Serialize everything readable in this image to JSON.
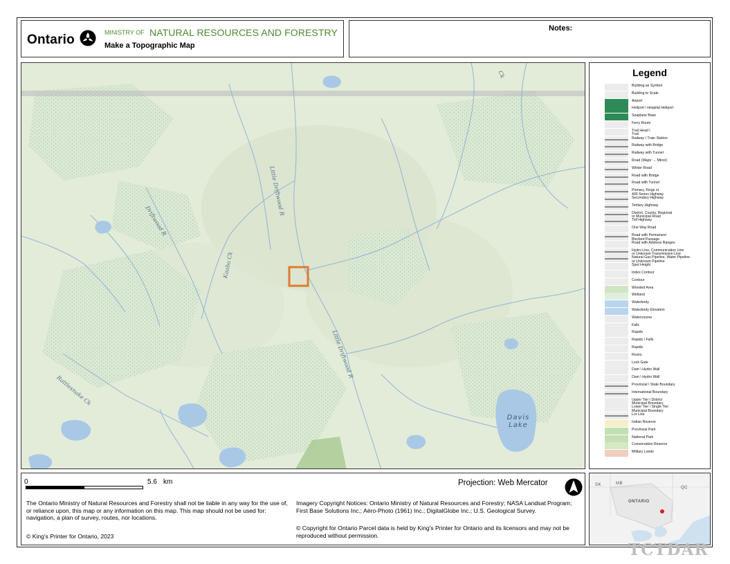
{
  "header": {
    "brand": "Ontario",
    "ministry_prefix": "MINISTRY OF",
    "ministry_name": "NATURAL RESOURCES AND FORESTRY",
    "tool_title": "Make a Topographic Map"
  },
  "notes": {
    "label": "Notes:"
  },
  "map": {
    "labels": {
      "little_driftwood_north": "Little Driftwood R",
      "driftwood": "Driftwood R",
      "kaaba": "Kaaba Ck",
      "little_driftwood_south": "Little Driftwood R",
      "rattlesnake": "Rattlesnake Ck",
      "top_right_creek": "Ck"
    },
    "lake": {
      "line1": "Davis",
      "line2": "Lake"
    },
    "colors": {
      "land": "#e3ecd9",
      "water": "#a9c8e6",
      "stream": "#8fb4d6",
      "boundary": "#b9b9b9",
      "selection": "#e07a2e",
      "park": "#a6c98e"
    }
  },
  "legend": {
    "title": "Legend",
    "items": [
      {
        "label": "Building as Symbol",
        "icon": "building-symbol"
      },
      {
        "label": "Building to Scale",
        "icon": "building-scale"
      },
      {
        "label": "Airport",
        "icon": "airport"
      },
      {
        "label": "Heliport \\ Hospital Heliport",
        "icon": "heliport"
      },
      {
        "label": "Seaplane Base",
        "icon": "seaplane"
      },
      {
        "label": "Ferry Route",
        "icon": "ferry"
      },
      {
        "label": "Trail Head \\\nTrail",
        "icon": "trail"
      },
      {
        "label": "Railway \\ Train Station",
        "icon": "railway-station"
      },
      {
        "label": "Railway with Bridge",
        "icon": "railway-bridge"
      },
      {
        "label": "Railway with Tunnel",
        "icon": "railway-tunnel"
      },
      {
        "label": "Road (Major → Minor)",
        "icon": "road"
      },
      {
        "label": "Winter Road",
        "icon": "winter-road"
      },
      {
        "label": "Road with Bridge",
        "icon": "road-bridge"
      },
      {
        "label": "Road with Tunnel",
        "icon": "road-tunnel"
      },
      {
        "label": "Primary, Kings or\n400 Series Highway",
        "icon": "primary-highway"
      },
      {
        "label": "Secondary Highway",
        "icon": "secondary-highway"
      },
      {
        "label": "Tertiary Highway",
        "icon": "tertiary-highway"
      },
      {
        "label": "District, County, Regional\nor Municipal Road",
        "icon": "district-road"
      },
      {
        "label": "Toll Highway",
        "icon": "toll-highway"
      },
      {
        "label": "One Way Road",
        "icon": "one-way"
      },
      {
        "label": "Road with Permanent\nBlocked Passage",
        "icon": "blocked-road"
      },
      {
        "label": "Road with Address Ranges",
        "icon": "address-range"
      },
      {
        "label": "Hydro Line, Communication Line\nor Unknown Transmission Line",
        "icon": "hydro-line"
      },
      {
        "label": "Natural Gas Pipeline, Water Pipeline\nor Unknown Pipeline",
        "icon": "pipeline"
      },
      {
        "label": "Spot Height",
        "icon": "spot-height"
      },
      {
        "label": "Index Contour",
        "icon": "index-contour"
      },
      {
        "label": "Contour",
        "icon": "contour"
      },
      {
        "label": "Wooded Area",
        "icon": "wooded-area"
      },
      {
        "label": "Wetland",
        "icon": "wetland"
      },
      {
        "label": "Waterbody",
        "icon": "waterbody"
      },
      {
        "label": "Waterbody Elevation",
        "icon": "waterbody-elevation"
      },
      {
        "label": "Watercourse",
        "icon": "watercourse"
      },
      {
        "label": "Falls",
        "icon": "falls"
      },
      {
        "label": "Rapids",
        "icon": "rapids"
      },
      {
        "label": "Rapids \\ Falls",
        "icon": "rapids-falls"
      },
      {
        "label": "Rapids",
        "icon": "rapids-2"
      },
      {
        "label": "Rocks",
        "icon": "rocks"
      },
      {
        "label": "Lock Gate",
        "icon": "lock-gate"
      },
      {
        "label": "Dam \\ Hydro Wall",
        "icon": "dam"
      },
      {
        "label": "Dam \\ Hydro Wall",
        "icon": "dam-2"
      },
      {
        "label": "Provincial \\ State Boundary",
        "icon": "provincial-boundary"
      },
      {
        "label": "International Boundary",
        "icon": "international-boundary"
      },
      {
        "label": "Upper Tier \\ District\nMunicipal Boundary",
        "icon": "upper-tier"
      },
      {
        "label": "Lower Tier \\ Single Tier\nMunicipal Boundary",
        "icon": "lower-tier"
      },
      {
        "label": "Lot Line",
        "icon": "lot-line"
      },
      {
        "label": "Indian Reserve",
        "icon": "indian-reserve"
      },
      {
        "label": "Provincial Park",
        "icon": "provincial-park"
      },
      {
        "label": "National Park",
        "icon": "national-park"
      },
      {
        "label": "Conservation Reserve",
        "icon": "conservation-reserve"
      },
      {
        "label": "Military Lands",
        "icon": "military-lands"
      }
    ]
  },
  "footer": {
    "scale_start": "0",
    "scale_end": "5.6",
    "scale_unit": "km",
    "projection": "Projection: Web Mercator",
    "disclaimer": "The Ontario Ministry of Natural Resources and Forestry shall not be liable in any way for the use of, or reliance upon, this map or any information on this map.  This map should not be used for: navigation, a plan of survey, routes, nor locations.",
    "copyright": "© King's Printer for Ontario,     2023",
    "imagery": "Imagery Copyright Notices: Ontario Ministry of Natural Resources and Forestry; NASA Landsat Program; First Base Solutions Inc.; Aéro-Photo (1961) Inc.; DigitalGlobe Inc.; U.S. Geological Survey.",
    "parcel": "© Copyright for Ontario Parcel data is held by King's Printer for Ontario and its licensors and may not be reproduced without permission."
  },
  "inset": {
    "labels": {
      "sk": "SK",
      "mb": "MB",
      "qc": "QC",
      "ontario": "ONTARIO"
    }
  },
  "watermark": "TCTDAR"
}
